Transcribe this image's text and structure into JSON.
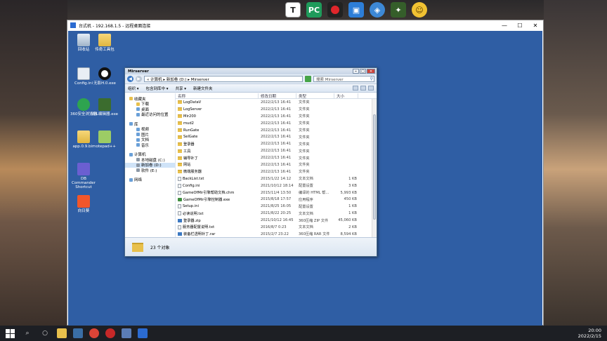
{
  "rdp_window": {
    "title": "台式机 - 192.168.1.5 - 远程桌面连接",
    "minimize": "—",
    "maximize": "☐",
    "close": "✕"
  },
  "desktop_icons": [
    {
      "label": "回收站"
    },
    {
      "label": "传奇工具包"
    },
    {
      "label": "Config.ini"
    },
    {
      "label": "无影H.0.exe"
    },
    {
      "label": "360安全浏览器"
    },
    {
      "label": "WIL编辑器.exe"
    },
    {
      "label": "app.0.9.bin"
    },
    {
      "label": "notepad++"
    },
    {
      "label": "DB Commander Shortcut"
    },
    {
      "label": "向日葵"
    }
  ],
  "explorer": {
    "title": "Mirserver",
    "breadcrumb": "« 计算机 ▸ 新加卷 (D:) ▸ Mirserver",
    "search_placeholder": "搜索 Mirserver",
    "toolbar": [
      "组织 ▾",
      "包含到库中 ▾",
      "共享 ▾",
      "新建文件夹"
    ],
    "nav": [
      {
        "label": "收藏夹",
        "sub": false,
        "icon": "star"
      },
      {
        "label": "下载",
        "sub": true,
        "icon": "folder"
      },
      {
        "label": "桌面",
        "sub": true,
        "icon": "desktop"
      },
      {
        "label": "最近访问的位置",
        "sub": true,
        "icon": "recent"
      },
      {
        "label": "",
        "gap": true
      },
      {
        "label": "库",
        "sub": false,
        "icon": "library"
      },
      {
        "label": "视频",
        "sub": true,
        "icon": "video"
      },
      {
        "label": "图片",
        "sub": true,
        "icon": "picture"
      },
      {
        "label": "文档",
        "sub": true,
        "icon": "document"
      },
      {
        "label": "音乐",
        "sub": true,
        "icon": "music"
      },
      {
        "label": "",
        "gap": true
      },
      {
        "label": "计算机",
        "sub": false,
        "icon": "computer"
      },
      {
        "label": "本地磁盘 (C:)",
        "sub": true,
        "icon": "drive"
      },
      {
        "label": "新加卷 (D:)",
        "sub": true,
        "icon": "drive",
        "selected": true
      },
      {
        "label": "软件 (E:)",
        "sub": true,
        "icon": "drive"
      },
      {
        "label": "",
        "gap": true
      },
      {
        "label": "网络",
        "sub": false,
        "icon": "network"
      }
    ],
    "columns": [
      "名称",
      "修改日期",
      "类型",
      "大小"
    ],
    "rows": [
      {
        "name": "LogDataV",
        "date": "2022/2/13 16:41",
        "type": "文件夹",
        "size": "",
        "kind": "folder"
      },
      {
        "name": "LogServer",
        "date": "2022/2/13 16:41",
        "type": "文件夹",
        "size": "",
        "kind": "folder"
      },
      {
        "name": "Mir200",
        "date": "2022/2/13 16:41",
        "type": "文件夹",
        "size": "",
        "kind": "folder"
      },
      {
        "name": "mud2",
        "date": "2022/2/13 16:41",
        "type": "文件夹",
        "size": "",
        "kind": "folder"
      },
      {
        "name": "RunGate",
        "date": "2022/2/13 16:41",
        "type": "文件夹",
        "size": "",
        "kind": "folder"
      },
      {
        "name": "SelGate",
        "date": "2022/2/13 16:41",
        "type": "文件夹",
        "size": "",
        "kind": "folder"
      },
      {
        "name": "登录器",
        "date": "2022/2/13 16:41",
        "type": "文件夹",
        "size": "",
        "kind": "folder"
      },
      {
        "name": "工具",
        "date": "2022/2/13 16:41",
        "type": "文件夹",
        "size": "",
        "kind": "folder"
      },
      {
        "name": "辅导补丁",
        "date": "2022/2/13 16:41",
        "type": "文件夹",
        "size": "",
        "kind": "folder"
      },
      {
        "name": "网站",
        "date": "2022/2/13 16:41",
        "type": "文件夹",
        "size": "",
        "kind": "folder"
      },
      {
        "name": "微端服务器",
        "date": "2022/2/13 16:41",
        "type": "文件夹",
        "size": "",
        "kind": "folder"
      },
      {
        "name": "BackList.txt",
        "date": "2015/1/22 14:12",
        "type": "文本文档",
        "size": "1 KB",
        "kind": "file"
      },
      {
        "name": "Config.ini",
        "date": "2021/10/12 18:14",
        "type": "配置设置",
        "size": "3 KB",
        "kind": "file"
      },
      {
        "name": "GameOfMir引擎帮助文档.chm",
        "date": "2015/11/4 13:50",
        "type": "编译的 HTML 帮...",
        "size": "5,993 KB",
        "kind": "file"
      },
      {
        "name": "GameOfMir引擎控制器.exe",
        "date": "2015/8/18 17:57",
        "type": "应用程序",
        "size": "450 KB",
        "kind": "app"
      },
      {
        "name": "Setup.ini",
        "date": "2021/8/25 16:05",
        "type": "配置设置",
        "size": "1 KB",
        "kind": "file"
      },
      {
        "name": "必读说明.txt",
        "date": "2021/8/22 20:25",
        "type": "文本文档",
        "size": "1 KB",
        "kind": "file"
      },
      {
        "name": "登录器.zip",
        "date": "2021/10/12 16:45",
        "type": "360压缩 ZIP 文件",
        "size": "45,060 KB",
        "kind": "zip"
      },
      {
        "name": "服务器配置说明.txt",
        "date": "2016/8/7 0:23",
        "type": "文本文档",
        "size": "2 KB",
        "kind": "file"
      },
      {
        "name": "装备栏透明补丁.rar",
        "date": "2015/2/7 23:22",
        "type": "360压缩 RAR 文件",
        "size": "8,594 KB",
        "kind": "zip"
      }
    ],
    "status_text": "23 个对象"
  },
  "host_taskbar": {
    "time": "20:00",
    "date": "2022/2/15"
  },
  "colors": {
    "remote_desktop_bg": "#2f5ea4",
    "folder": "#e8c04c",
    "selection": "#cfe3f8"
  }
}
